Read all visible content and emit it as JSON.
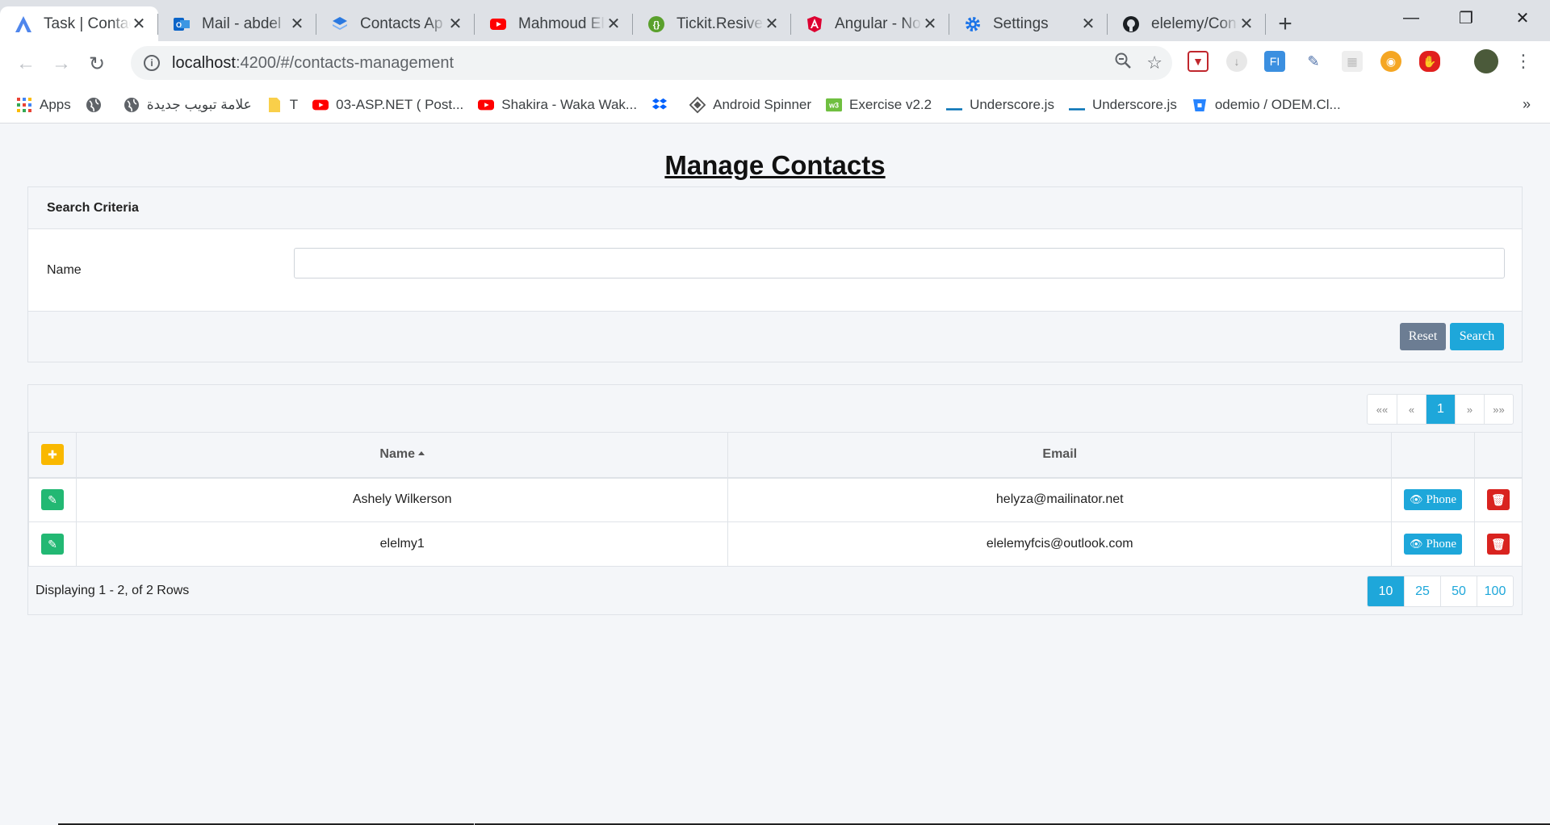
{
  "browser": {
    "tabs": [
      {
        "title": "Task | Contac",
        "icon": "angular-a-icon",
        "active": true
      },
      {
        "title": "Mail - abdel",
        "icon": "outlook-icon"
      },
      {
        "title": "Contacts Ap",
        "icon": "layers-icon"
      },
      {
        "title": "Mahmoud El",
        "icon": "youtube-icon"
      },
      {
        "title": "Tickit.Resive",
        "icon": "braces-icon"
      },
      {
        "title": "Angular - No",
        "icon": "angular-icon"
      },
      {
        "title": "Settings",
        "icon": "gear-icon"
      },
      {
        "title": "elelemy/Con",
        "icon": "github-icon"
      }
    ],
    "url_host": "localhost",
    "url_path": ":4200/#/contacts-management",
    "bookmarks": [
      {
        "label": "Apps",
        "icon": "apps-grid-icon"
      },
      {
        "label": "",
        "icon": "globe-icon"
      },
      {
        "label": "علامة تبويب جديدة",
        "icon": "globe-icon"
      },
      {
        "label": "T",
        "icon": "folder-icon"
      },
      {
        "label": "03-ASP.NET ( Post...",
        "icon": "youtube-icon"
      },
      {
        "label": "Shakira - Waka Wak...",
        "icon": "youtube-icon"
      },
      {
        "label": "",
        "icon": "dropbox-icon"
      },
      {
        "label": "Android Spinner",
        "icon": "diamond-icon"
      },
      {
        "label": "Exercise v2.2",
        "icon": "w3-icon"
      },
      {
        "label": "Underscore.js",
        "icon": "underscore-icon"
      },
      {
        "label": "Underscore.js",
        "icon": "underscore-icon"
      },
      {
        "label": "odemio / ODEM.Cl...",
        "icon": "bitbucket-icon"
      }
    ],
    "bookmarks_more": "»"
  },
  "page": {
    "title": "Manage Contacts",
    "search": {
      "header": "Search Criteria",
      "name_label": "Name",
      "name_value": "",
      "reset_label": "Reset",
      "search_label": "Search"
    },
    "pager": {
      "first": "««",
      "prev": "«",
      "current": "1",
      "next": "»",
      "last": "»»"
    },
    "table": {
      "columns": {
        "name": "Name",
        "email": "Email"
      },
      "sort": "name-asc",
      "rows": [
        {
          "name": "Ashely Wilkerson",
          "email": "helyza@mailinator.net",
          "phone_label": "Phone"
        },
        {
          "name": "elelmy1",
          "email": "elelemyfcis@outlook.com",
          "phone_label": "Phone"
        }
      ]
    },
    "rows_info": "Displaying 1 - 2, of 2 Rows",
    "page_sizes": [
      "10",
      "25",
      "50",
      "100"
    ],
    "page_size_selected": "10"
  },
  "colors": {
    "primary": "#1ea7da",
    "reset": "#6c7d93",
    "add": "#f9b800",
    "edit": "#22b873",
    "delete": "#d9231f"
  }
}
